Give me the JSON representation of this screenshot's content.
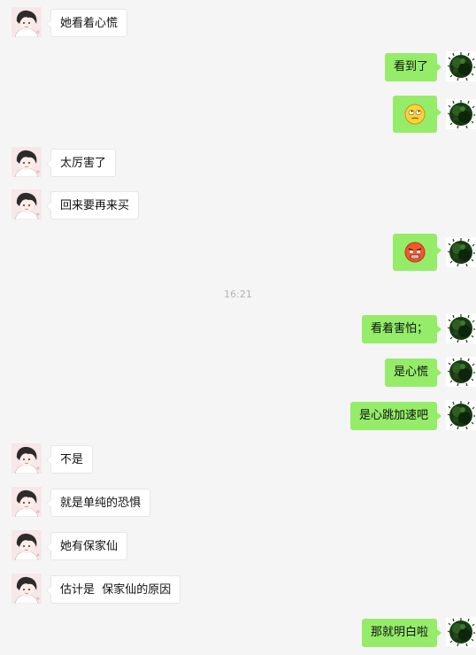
{
  "time_divider": "16:21",
  "messages": [
    {
      "side": "left",
      "text": "她看着心慌"
    },
    {
      "side": "right",
      "text": "看到了"
    },
    {
      "side": "right",
      "emoji": "rolling-eyes-emoji"
    },
    {
      "side": "left",
      "text": "太厉害了"
    },
    {
      "side": "left",
      "text": "回来要再来买"
    },
    {
      "side": "right",
      "emoji": "angry-face-emoji"
    },
    {
      "side": "right",
      "text": "看着害怕；"
    },
    {
      "side": "right",
      "text": "是心慌"
    },
    {
      "side": "right",
      "text": "是心跳加速吧"
    },
    {
      "side": "left",
      "text": "不是"
    },
    {
      "side": "left",
      "text": "就是单纯的恐惧"
    },
    {
      "side": "left",
      "text": "她有保家仙"
    },
    {
      "side": "left",
      "text": "估计是  保家仙的原因"
    },
    {
      "side": "right",
      "text": "那就明白啦"
    }
  ],
  "colors": {
    "background": "#f5f5f5",
    "own_bubble": "#95ec69",
    "other_bubble": "#ffffff",
    "timestamp": "#b2b2b2"
  },
  "icons": {
    "contact_avatar": "boy-avatar-icon",
    "own_avatar": "dark-green-ball-avatar-icon"
  }
}
